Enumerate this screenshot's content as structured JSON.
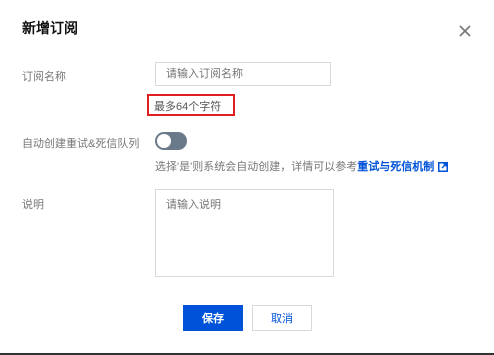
{
  "dialog": {
    "title": "新增订阅",
    "close_icon": "close-icon"
  },
  "form": {
    "name_label": "订阅名称",
    "name_placeholder": "请输入订阅名称",
    "name_hint": "最多64个字符",
    "retry_label": "自动创建重试&死信队列",
    "retry_toggle_on": false,
    "retry_desc": "选择'是'则系统会自动创建，详情可以参考",
    "retry_link": "重试与死信机制",
    "external_link_icon": "external-link-icon",
    "desc_label": "说明",
    "desc_placeholder": "请输入说明"
  },
  "buttons": {
    "save": "保存",
    "cancel": "取消"
  },
  "colors": {
    "primary": "#0052d9",
    "highlight_border": "#e02020",
    "toggle_off": "#6b7a8b"
  }
}
